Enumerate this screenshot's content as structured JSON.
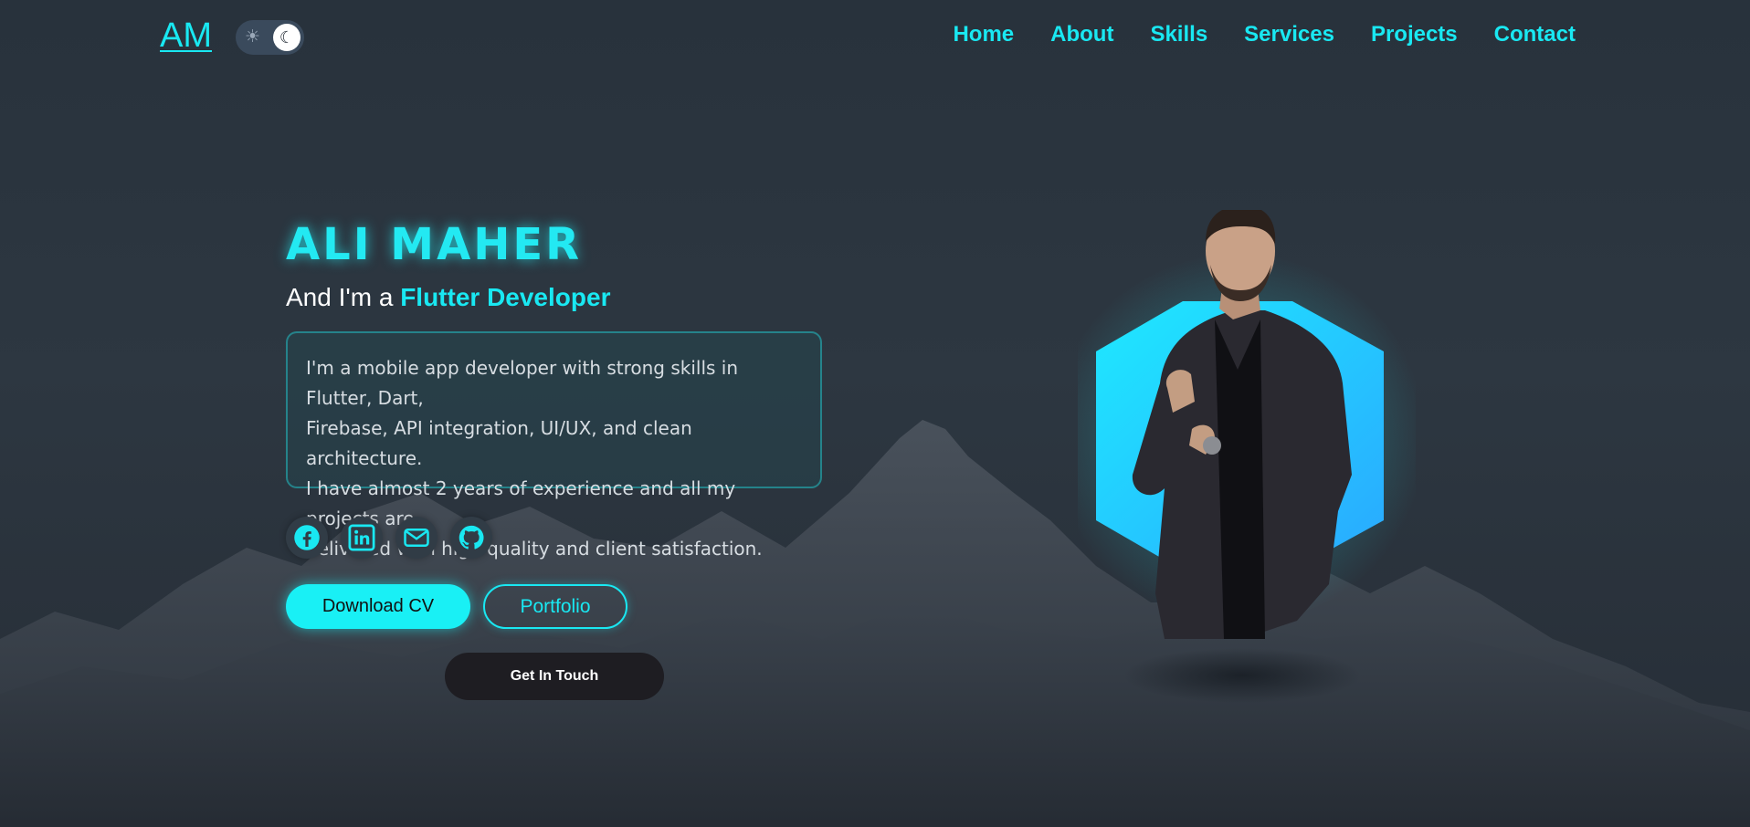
{
  "header": {
    "logo": "AM",
    "nav": [
      "Home",
      "About",
      "Skills",
      "Services",
      "Projects",
      "Contact"
    ],
    "theme_toggle": {
      "sun_icon": "sun-icon",
      "moon_icon": "moon-icon",
      "mode": "dark"
    }
  },
  "hero": {
    "name": "ALI MAHER",
    "role_prefix": "And I'm a ",
    "role_highlight": "Flutter Developer",
    "about_lines": [
      "I'm a mobile app developer with strong skills in Flutter, Dart,",
      "Firebase, API integration, UI/UX, and clean architecture.",
      "I have almost 2 years of experience and all my projects are",
      "delivered with high quality and client satisfaction."
    ],
    "socials": [
      "facebook-icon",
      "linkedin-icon",
      "mail-icon",
      "github-icon"
    ],
    "buttons": {
      "download_cv": "Download CV",
      "portfolio": "Portfolio",
      "get_in_touch": "Get In Touch"
    }
  },
  "colors": {
    "accent": "#19e8f2",
    "background": "#2a333d",
    "hexagon_top": "#1ae6ff",
    "hexagon_bottom": "#2fb0ff"
  }
}
